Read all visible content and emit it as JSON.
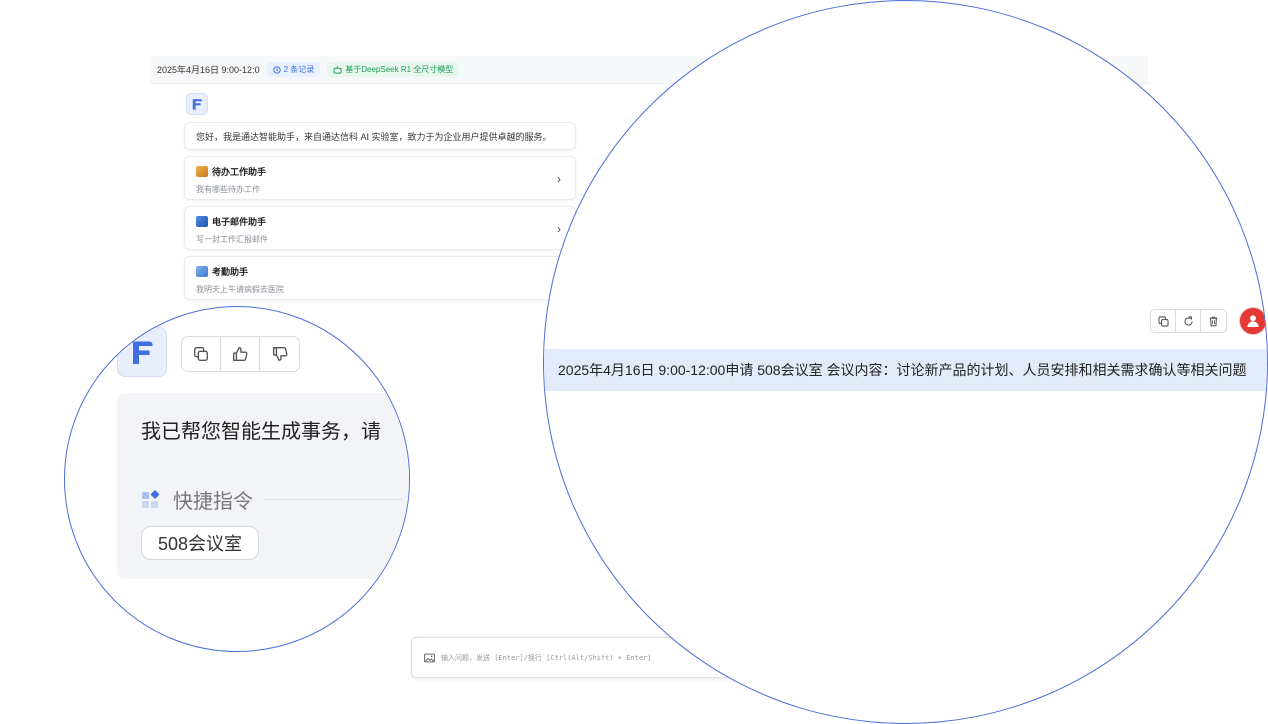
{
  "topbar": {
    "title": "2025年4月16日 9:00-12:0",
    "records": "2 条记录",
    "model": "基于DeepSeek R1 全尺寸模型"
  },
  "chat": {
    "greeting": "您好，我是通达智能助手，来自通达信科 AI 实验室，致力于为企业用户提供卓越的服务。",
    "cards": [
      {
        "title": "待办工作助手",
        "subtitle": "我有哪些待办工作",
        "icon": "todo-icon"
      },
      {
        "title": "电子邮件助手",
        "subtitle": "写一封工作汇报邮件",
        "icon": "email-icon"
      },
      {
        "title": "考勤助手",
        "subtitle": "我明天上午请病假去医院",
        "icon": "attendance-icon"
      }
    ]
  },
  "zoom_left": {
    "reply": "我已帮您智能生成事务，请",
    "quick_label": "快捷指令",
    "quick_command": "508会议室"
  },
  "zoom_right": {
    "user_message": "2025年4月16日 9:00-12:00申请 508会议室 会议内容：讨论新产品的计划、人员安排和相关需求确认等相关问题"
  },
  "input": {
    "placeholder": "输入问题，发送 [Enter]/换行 [Ctrl(Alt/Shift) + Enter]"
  },
  "colors": {
    "brand": "#3f6fe0",
    "user_avatar": "#e53935",
    "user_bubble": "#e3ebfb",
    "model_chip": "#1f9d55"
  }
}
